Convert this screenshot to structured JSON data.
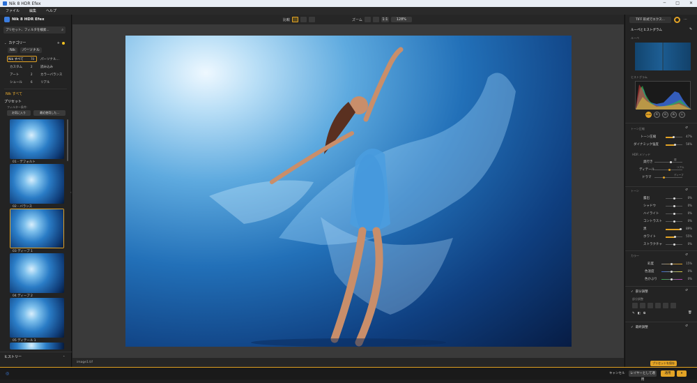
{
  "window": {
    "title": "Nik 8 HDR Efex"
  },
  "menu": [
    "ファイル",
    "編集",
    "ヘルプ"
  ],
  "left_panel": {
    "app_name": "Nik 8 HDR Efex",
    "search_placeholder": "プリセット、フィルタを検索...",
    "categories_title": "カテゴリー",
    "chips": [
      "Nik",
      "パーソナル"
    ],
    "category_items": [
      {
        "label": "Nik すべて",
        "count": "70"
      },
      {
        "label": "パーソナル…",
        "count": ""
      },
      {
        "label": "カスタム",
        "count": "2"
      },
      {
        "label": "読み込み",
        "count": ""
      },
      {
        "label": "アート",
        "count": "2"
      },
      {
        "label": "カラーバランス",
        "count": ""
      },
      {
        "label": "シュール",
        "count": "6"
      },
      {
        "label": "リアル",
        "count": ""
      }
    ],
    "current_category": "Nik すべて",
    "presets_title": "プリセット",
    "filter_label": "フィルター条件:",
    "favorites_btn": "お気に入り",
    "recent_btn": "最近使用した...",
    "presets": [
      {
        "label": "01 - デフォルト",
        "selected": false
      },
      {
        "label": "02 - バランス",
        "selected": false
      },
      {
        "label": "03 ディープ 1",
        "selected": true
      },
      {
        "label": "04 ディープ 2",
        "selected": false
      },
      {
        "label": "05 ディテール 1",
        "selected": false
      }
    ],
    "history_title": "ヒストリー"
  },
  "topbar": {
    "compare_label": "比較",
    "zoom_label": "ズーム",
    "zoom_ratio": "1:1",
    "zoom_value": "128%"
  },
  "status": {
    "filename": "image1.tif"
  },
  "right_panel": {
    "export_format": "TIFF 形式でエクス...",
    "loupe_title": "ルーペとヒストグラム",
    "loupe_label": "ルーペ",
    "histogram_label": "ヒストグラム",
    "channels": [
      "RGB",
      "R",
      "G",
      "B",
      "L"
    ],
    "tone_compression_title": "トーン圧縮",
    "tone_sliders": [
      {
        "label": "トーン圧縮",
        "value": "47%",
        "pct": 0.47
      },
      {
        "label": "ダイナミック強度",
        "value": "56%",
        "pct": 0.56
      }
    ],
    "hdr_method_title": "HDR メソッド",
    "hdr_items": [
      "奥行き",
      "ディテール",
      "ドラマ"
    ],
    "hdr_tags": [
      "弱",
      "リアル",
      "ディープ"
    ],
    "tone_title": "トーン",
    "tone_items": [
      {
        "label": "露出",
        "value": "0%",
        "pct": 0.0
      },
      {
        "label": "シャドウ",
        "value": "0%",
        "pct": 0.0
      },
      {
        "label": "ハイライト",
        "value": "0%",
        "pct": 0.0
      },
      {
        "label": "コントラスト",
        "value": "0%",
        "pct": 0.0
      },
      {
        "label": "黒",
        "value": "89%",
        "pct": 0.89
      },
      {
        "label": "ホワイト",
        "value": "55%",
        "pct": 0.55
      },
      {
        "label": "ストラクチャ",
        "value": "0%",
        "pct": 0.0
      }
    ],
    "color_title": "カラー",
    "color_items": [
      {
        "label": "彩度",
        "value": "15%",
        "pct": 0.15
      },
      {
        "label": "色温度",
        "value": "0%",
        "pct": 0.0
      },
      {
        "label": "色かぶり",
        "value": "0%",
        "pct": 0.0
      }
    ],
    "local_adjust_title": "部分調整",
    "local_adjust_sub": "部分調整",
    "finish_title": "最終調整",
    "save_preset_btn": "プリセットを保存"
  },
  "bottom": {
    "cancel": "キャンセル",
    "apply_as_layer": "レイヤーとして適用",
    "apply": "適用"
  },
  "colors": {
    "accent": "#e3a325",
    "panel": "#232323",
    "canvas": "#3a3a3a"
  }
}
